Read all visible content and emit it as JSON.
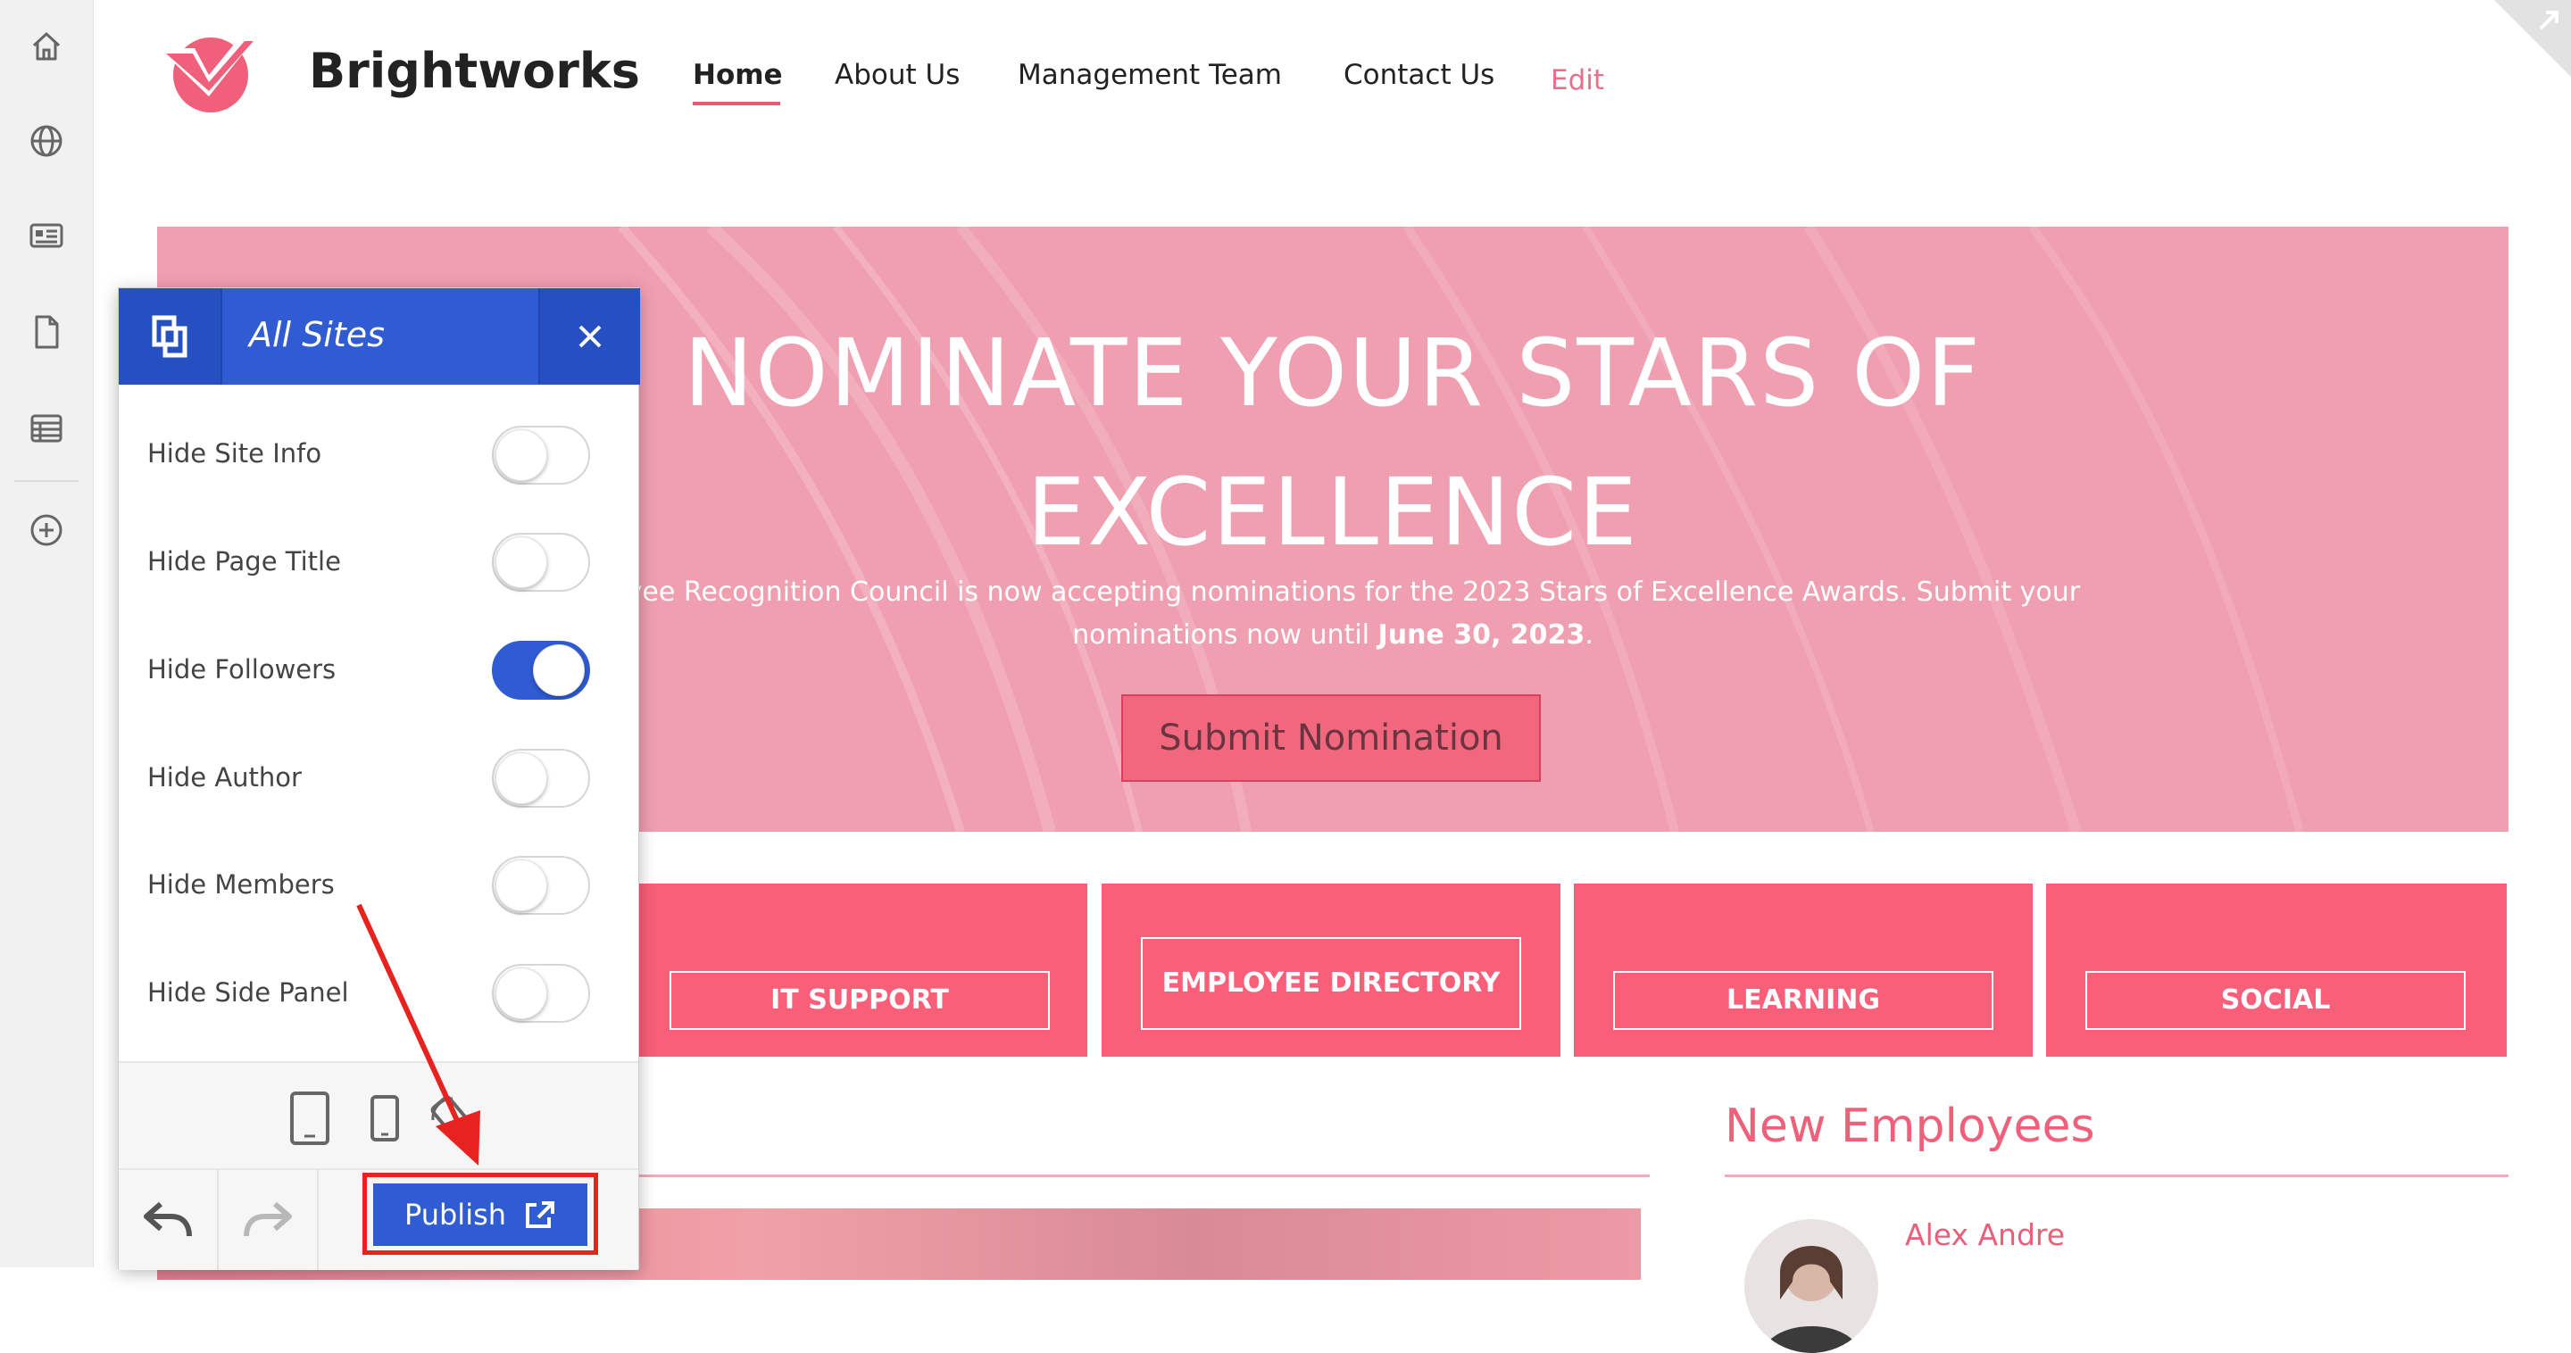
{
  "rail": {
    "icons": [
      "home-icon",
      "globe-icon",
      "news-icon",
      "document-icon",
      "table-icon",
      "add-icon"
    ]
  },
  "site": {
    "name": "Brightworks",
    "brand_color": "#f0607a"
  },
  "nav": {
    "items": [
      {
        "label": "Home",
        "active": true
      },
      {
        "label": "About Us"
      },
      {
        "label": "Management Team"
      },
      {
        "label": "Contact Us"
      }
    ],
    "edit_label": "Edit"
  },
  "hero": {
    "title_line1": "NOMINATE YOUR STARS OF",
    "title_line2": "EXCELLENCE",
    "text_line1": "ployee Recognition Council is now accepting nominations for the 2023 Stars of Excellence Awards. Submit your",
    "text_line2_a": "nominations now until ",
    "text_line2_bold": "June 30, 2023",
    "text_line2_b": ".",
    "button_label": "Submit Nomination"
  },
  "tiles": [
    {
      "label": "IT SUPPORT"
    },
    {
      "label": "EMPLOYEE DIRECTORY"
    },
    {
      "label": "LEARNING"
    },
    {
      "label": "SOCIAL"
    }
  ],
  "new_employees": {
    "title": "New Employees",
    "first_name": "Alex Andre"
  },
  "panel": {
    "title": "All Sites",
    "options": [
      {
        "label": "Hide Site Info",
        "on": false
      },
      {
        "label": "Hide Page Title",
        "on": false
      },
      {
        "label": "Hide Followers",
        "on": true
      },
      {
        "label": "Hide Author",
        "on": false
      },
      {
        "label": "Hide Members",
        "on": false
      },
      {
        "label": "Hide Side Panel",
        "on": false
      }
    ],
    "devices": [
      "tablet-icon",
      "phone-icon",
      "rotate-icon"
    ],
    "publish_label": "Publish",
    "accent": "#2f5bd3",
    "annotation_color": "#e8231f"
  }
}
